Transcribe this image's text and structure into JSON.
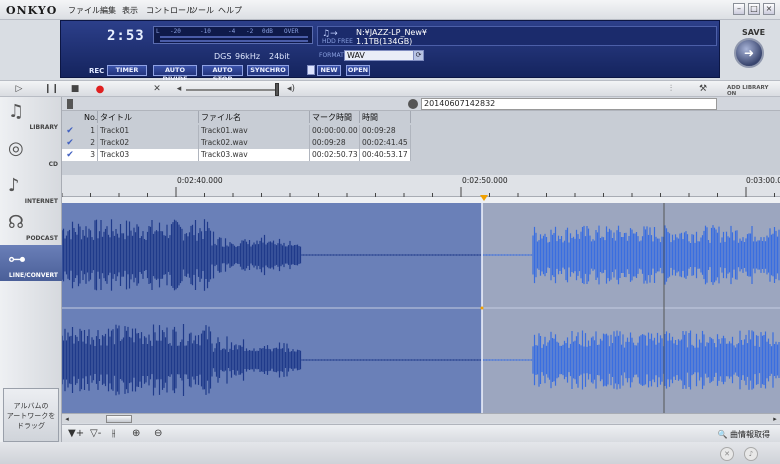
{
  "app": {
    "logo": "ONKYO",
    "menu": [
      "ファイル",
      "編集",
      "表示",
      "コントロール",
      "ツール",
      "ヘルプ"
    ]
  },
  "display": {
    "time": "2:53",
    "meter_labels": [
      "L",
      "-20",
      "-10",
      "-4",
      "-2",
      "0dB",
      "OVER"
    ],
    "folder_path": "N:¥JAZZ-LP_New¥",
    "hdd_free_label": "HDD FREE",
    "hdd_free": "1.1TB(134GB)",
    "spec_mode": "DGS",
    "sample_rate": "96kHz",
    "bit_depth": "24bit",
    "format_label": "FORMAT",
    "format_value": "WAV",
    "rec_label": "REC",
    "buttons": {
      "timer": "TIMER",
      "auto_divide": "AUTO DIVIDE",
      "auto_stop": "AUTO STOP",
      "synchro": "SYNCHRO",
      "new": "NEW",
      "open": "OPEN"
    }
  },
  "save": {
    "label": "SAVE"
  },
  "transport": {
    "add_library_label": "ADD LIBRARY",
    "add_library_state": "ON"
  },
  "sidebar": {
    "items": [
      {
        "label": "LIBRARY",
        "icon": "library-icon"
      },
      {
        "label": "CD",
        "icon": "cd-icon"
      },
      {
        "label": "INTERNET",
        "icon": "internet-icon"
      },
      {
        "label": "PODCAST",
        "icon": "podcast-icon"
      },
      {
        "label": "LINE/CONVERT",
        "icon": "line-convert-icon"
      }
    ],
    "artwork_drop": "アルバムの\nアートワークを\nドラッグ"
  },
  "project": {
    "name": "20140607142832"
  },
  "tracks": {
    "headers": [
      "No.",
      "タイトル",
      "ファイル名",
      "マーク時間",
      "時間"
    ],
    "rows": [
      {
        "no": "1",
        "title": "Track01",
        "file": "Track01.wav",
        "mark": "00:00:00.00",
        "time": "00:09:28"
      },
      {
        "no": "2",
        "title": "Track02",
        "file": "Track02.wav",
        "mark": "00:09:28",
        "time": "00:02:41.45"
      },
      {
        "no": "3",
        "title": "Track03",
        "file": "Track03.wav",
        "mark": "00:02:50.73",
        "time": "00:40:53.17"
      }
    ]
  },
  "timeline": {
    "labels": [
      "0:02:40.000",
      "0:02:50.000",
      "0:03:00.00"
    ]
  },
  "bottom": {
    "track_info_label": "曲情報取得"
  },
  "colors": {
    "panel_blue": "#1c2c6e",
    "wave_bg_selected": "#6a80b8",
    "wave_bg_unselected": "#9ca6bf",
    "wave_dark": "#1f3a8a",
    "wave_bright": "#3a6ee0",
    "marker": "#f0a000",
    "record": "#e02020"
  }
}
